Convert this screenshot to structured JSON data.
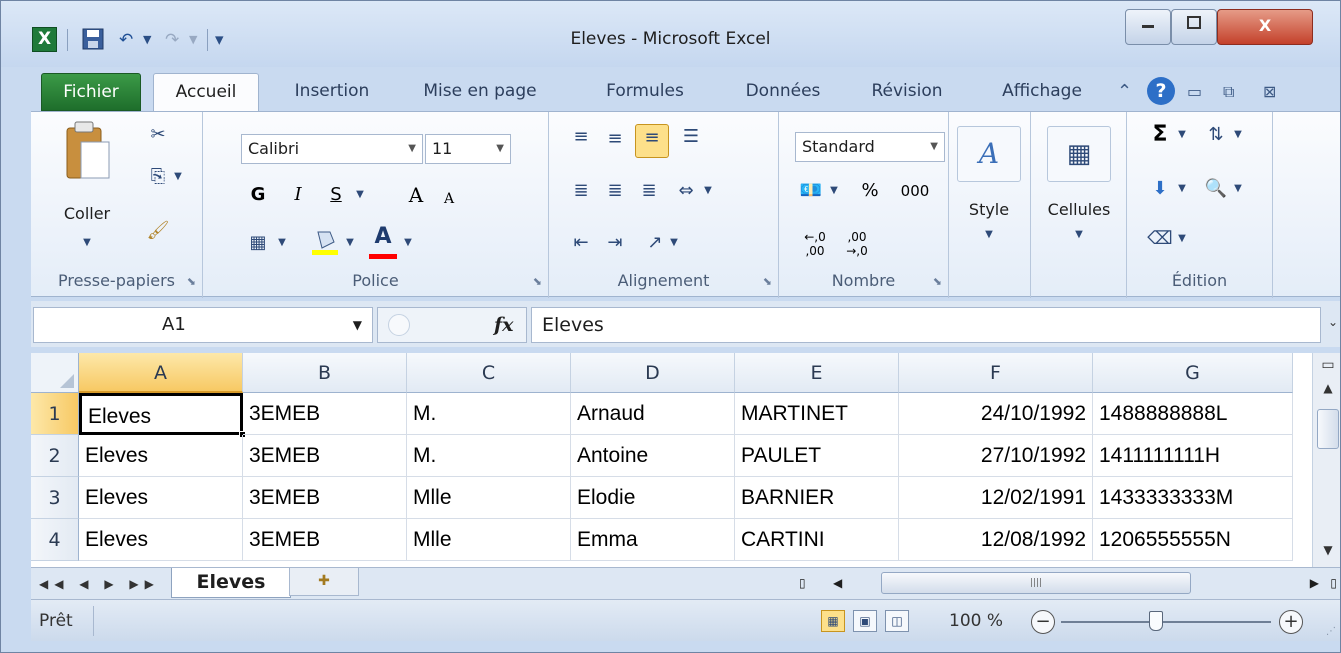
{
  "window": {
    "title": "Eleves - Microsoft Excel",
    "app_icon_label": "X",
    "minimize_label": "▭",
    "maximize_label": "▢",
    "close_label": "X"
  },
  "quick_access": {
    "save_icon": "save-icon",
    "undo_glyph": "↶",
    "redo_glyph": "↷",
    "customize_glyph": "▾"
  },
  "ribbon_tabs": [
    "Fichier",
    "Accueil",
    "Insertion",
    "Mise en page",
    "Formules",
    "Données",
    "Révision",
    "Affichage"
  ],
  "ribbon": {
    "clipboard": {
      "paste_label": "Coller",
      "group_label": "Presse-papiers"
    },
    "font": {
      "font_name": "Calibri",
      "font_size": "11",
      "bold": "G",
      "italic": "I",
      "underline": "S",
      "grow": "A",
      "shrink": "A",
      "font_color": "A",
      "group_label": "Police",
      "highlight_color": "#ffff00",
      "text_color": "#ff0000"
    },
    "alignment": {
      "group_label": "Alignement"
    },
    "number": {
      "format": "Standard",
      "percent": "%",
      "thousands": "000",
      "dec_inc": "←,0 ,00",
      "dec_dec": ",00 →,0",
      "group_label": "Nombre"
    },
    "styles": {
      "label": "Style"
    },
    "cells": {
      "label": "Cellules"
    },
    "editing": {
      "sum": "Σ",
      "group_label": "Édition"
    }
  },
  "formula_bar": {
    "name_box": "A1",
    "fx": "fx",
    "value": "Eleves"
  },
  "grid": {
    "columns": [
      "A",
      "B",
      "C",
      "D",
      "E",
      "F",
      "G"
    ],
    "rows": [
      {
        "num": "1",
        "cells": [
          "Eleves",
          "3EMEB",
          "M.",
          "Arnaud",
          "MARTINET",
          "24/10/1992",
          "1488888888L"
        ]
      },
      {
        "num": "2",
        "cells": [
          "Eleves",
          "3EMEB",
          "M.",
          "Antoine",
          "PAULET",
          "27/10/1992",
          "1411111111H"
        ]
      },
      {
        "num": "3",
        "cells": [
          "Eleves",
          "3EMEB",
          "Mlle",
          "Elodie",
          "BARNIER",
          "12/02/1991",
          "1433333333M"
        ]
      },
      {
        "num": "4",
        "cells": [
          "Eleves",
          "3EMEB",
          "Mlle",
          "Emma",
          "CARTINI",
          "12/08/1992",
          "1206555555N"
        ]
      }
    ]
  },
  "sheets": {
    "tabs": [
      "Eleves"
    ],
    "nav": "◀◀ ◀ ▶ ▶▶"
  },
  "status": {
    "ready": "Prêt",
    "zoom": "100 %",
    "zoom_level": 0.5
  }
}
